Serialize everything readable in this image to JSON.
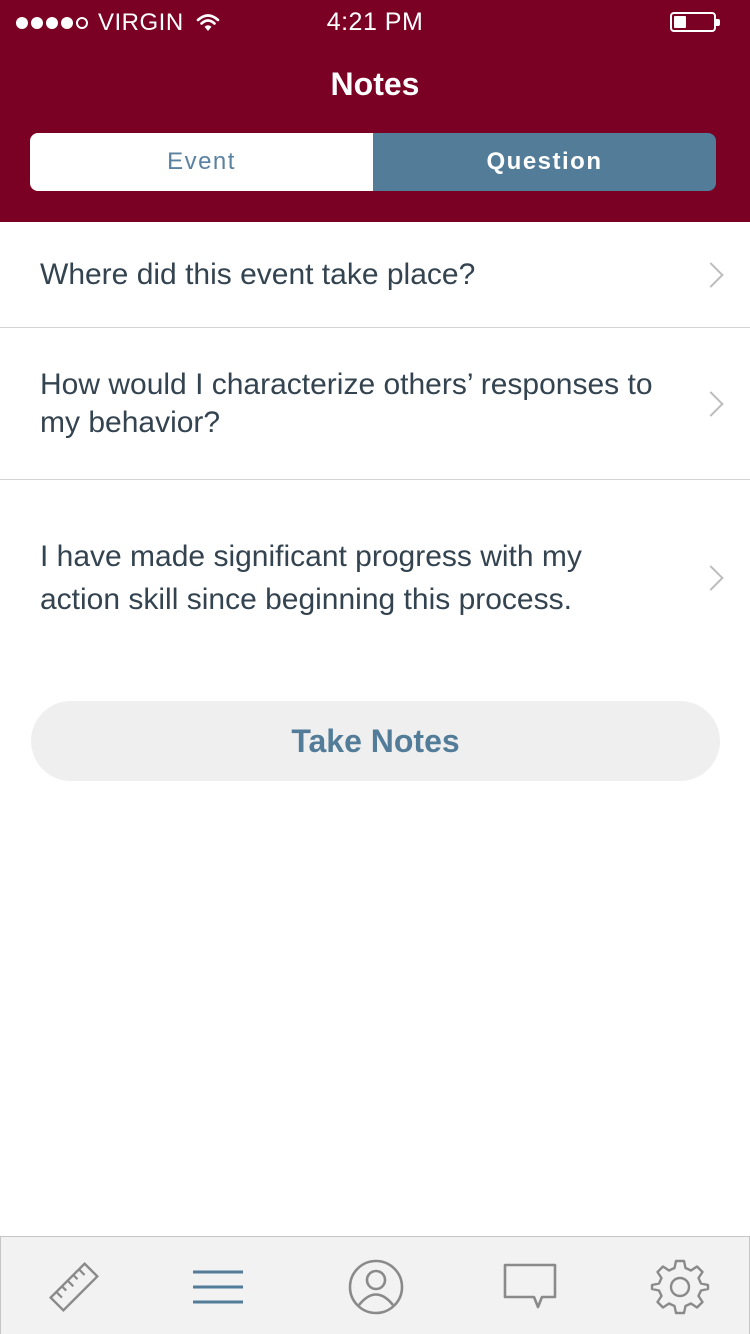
{
  "status_bar": {
    "carrier": "VIRGIN",
    "time": "4:21 PM",
    "signal_bars_filled": 4,
    "signal_bars_total": 5,
    "battery_level": 0.25
  },
  "header": {
    "title": "Notes",
    "background_color": "#7a0024"
  },
  "segments": {
    "event_label": "Event",
    "question_label": "Question",
    "selected": "Question"
  },
  "questions": [
    {
      "text": "Where did this event take place?"
    },
    {
      "text": "How would I characterize others’ responses to my behavior?"
    },
    {
      "text": "I have made significant progress with my action skill since beginning this process."
    }
  ],
  "actions": {
    "take_notes_label": "Take Notes"
  },
  "tab_bar": {
    "items": [
      {
        "icon": "ruler-icon"
      },
      {
        "icon": "menu-icon"
      },
      {
        "icon": "profile-icon"
      },
      {
        "icon": "chat-icon"
      },
      {
        "icon": "gear-icon"
      }
    ]
  },
  "colors": {
    "accent": "#537c99",
    "text": "#33434f",
    "icon": "#8a8a8a"
  }
}
